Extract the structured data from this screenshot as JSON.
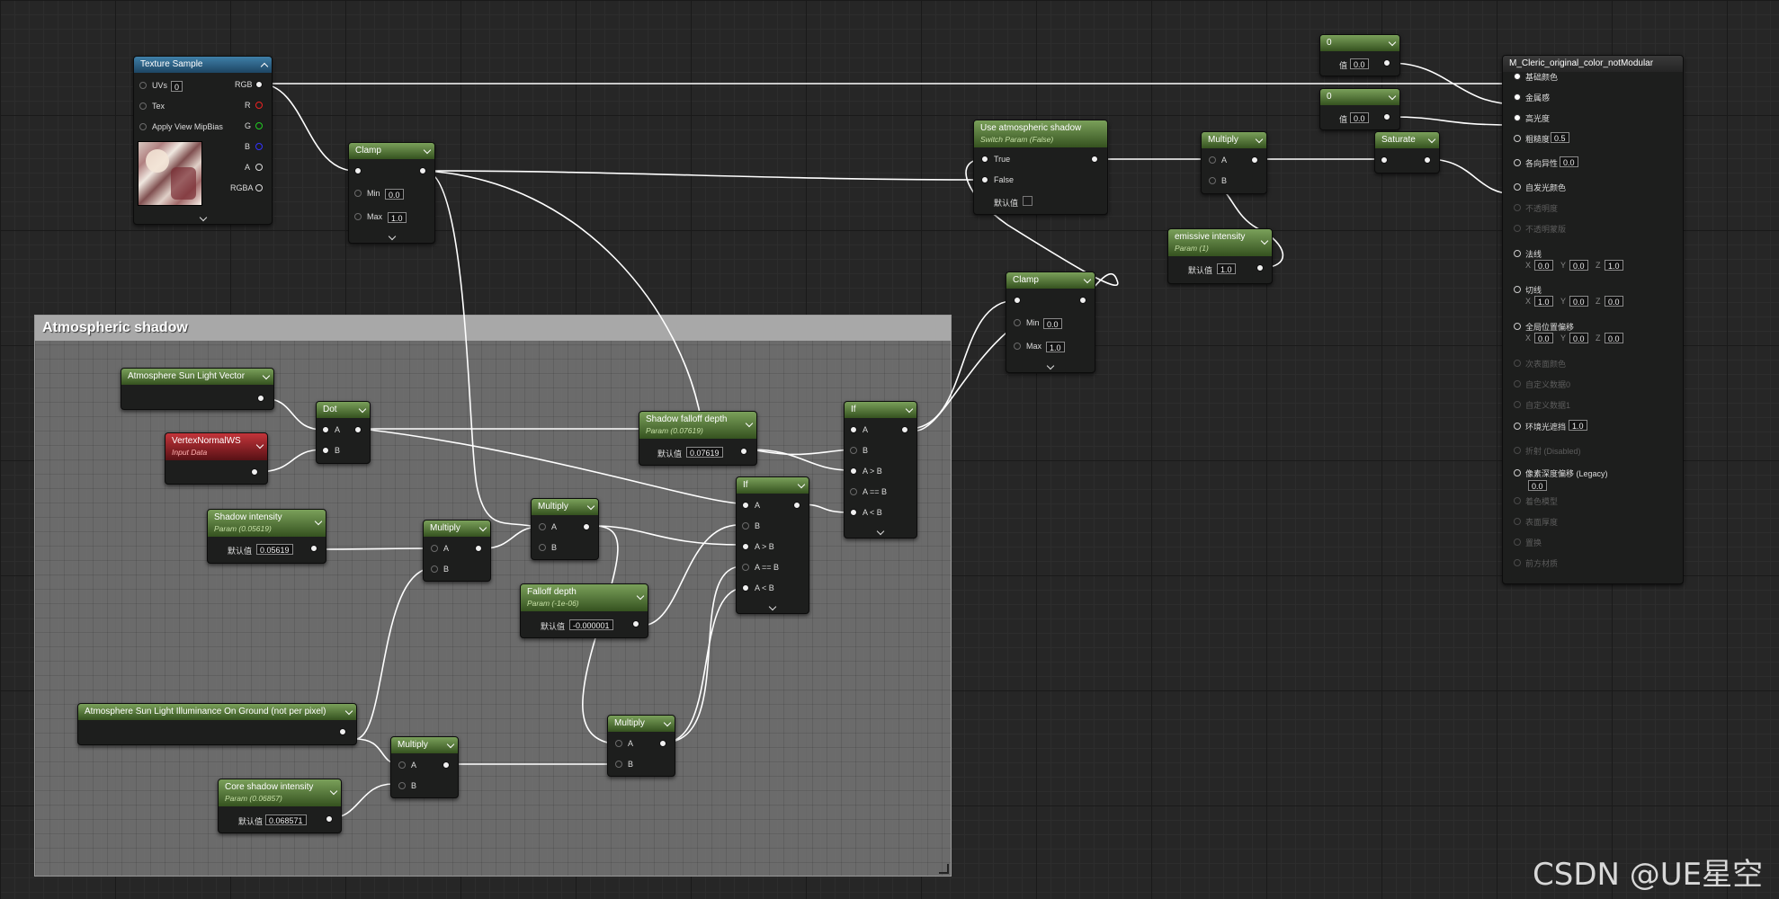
{
  "comment": {
    "title": "Atmospheric shadow"
  },
  "texture_sample": {
    "title": "Texture Sample",
    "uvs": "UVs",
    "uvs_value": "0",
    "tex": "Tex",
    "mip": "Apply View MipBias",
    "rgb": "RGB",
    "r": "R",
    "g": "G",
    "b": "B",
    "a": "A",
    "rgba": "RGBA"
  },
  "clamp1": {
    "title": "Clamp",
    "min_label": "Min",
    "min": "0.0",
    "max_label": "Max",
    "max": "1.0"
  },
  "clamp2": {
    "title": "Clamp",
    "min_label": "Min",
    "min": "0.0",
    "max_label": "Max",
    "max": "1.0"
  },
  "const_a": {
    "title": "0",
    "label": "值",
    "value": "0.0"
  },
  "const_b": {
    "title": "0",
    "label": "值",
    "value": "0.0"
  },
  "use_atmo": {
    "title": "Use atmospheric shadow",
    "sub": "Switch Param (False)",
    "true_label": "True",
    "false_label": "False",
    "default_label": "默认值"
  },
  "multiply_top": {
    "title": "Multiply",
    "a": "A",
    "b": "B"
  },
  "saturate": {
    "title": "Saturate"
  },
  "emissive": {
    "title": "emissive intensity",
    "sub": "Param (1)",
    "label": "默认值",
    "value": "1.0"
  },
  "material": {
    "title": "M_Cleric_original_color_notModular",
    "pins": [
      {
        "label": "基础颜色"
      },
      {
        "label": "金属感"
      },
      {
        "label": "高光度"
      },
      {
        "label": "粗糙度",
        "v": "0.5"
      },
      {
        "label": "各向异性",
        "v": "0.0"
      },
      {
        "label": "自发光颜色"
      },
      {
        "label": "不透明度"
      },
      {
        "label": "不透明蒙版"
      },
      {
        "label": "法线",
        "x": "0.0",
        "y": "0.0",
        "z": "1.0"
      },
      {
        "label": "切线",
        "x": "1.0",
        "y": "0.0",
        "z": "0.0"
      },
      {
        "label": "全局位置偏移",
        "x": "0.0",
        "y": "0.0",
        "z": "0.0"
      },
      {
        "label": "次表面颜色"
      },
      {
        "label": "自定义数据0"
      },
      {
        "label": "自定义数据1"
      },
      {
        "label": "环境光遮挡",
        "v": "1.0"
      },
      {
        "label": "折射 (Disabled)"
      },
      {
        "label": "像素深度偏移 (Legacy)",
        "v": "0.0"
      },
      {
        "label": "着色模型"
      },
      {
        "label": "表面厚度"
      },
      {
        "label": "置换"
      },
      {
        "label": "前方材质"
      }
    ],
    "x_label": "X",
    "y_label": "Y",
    "z_label": "Z"
  },
  "sun_vec": {
    "title": "Atmosphere Sun Light Vector"
  },
  "vertex_normal": {
    "title": "VertexNormalWS",
    "sub": "Input Data"
  },
  "dot": {
    "title": "Dot",
    "a": "A",
    "b": "B"
  },
  "shadow_intensity": {
    "title": "Shadow intensity",
    "sub": "Param (0.05619)",
    "label": "默认值",
    "value": "0.05619"
  },
  "multiply_a": {
    "title": "Multiply",
    "a": "A",
    "b": "B"
  },
  "multiply_b": {
    "title": "Multiply",
    "a": "A",
    "b": "B"
  },
  "shadow_falloff": {
    "title": "Shadow falloff depth",
    "sub": "Param (0.07619)",
    "label": "默认值",
    "value": "0.07619"
  },
  "falloff_depth": {
    "title": "Falloff depth",
    "sub": "Param (-1e-06)",
    "label": "默认值",
    "value": "-0.000001"
  },
  "if1": {
    "title": "If",
    "a": "A",
    "b": "B",
    "gt": "A > B",
    "eq": "A == B",
    "lt": "A < B"
  },
  "if2": {
    "title": "If",
    "a": "A",
    "b": "B",
    "gt": "A > B",
    "eq": "A == B",
    "lt": "A < B"
  },
  "sun_illum": {
    "title": "Atmosphere Sun Light Illuminance On Ground (not per pixel)"
  },
  "multiply_c": {
    "title": "Multiply",
    "a": "A",
    "b": "B"
  },
  "multiply_d": {
    "title": "Multiply",
    "a": "A",
    "b": "B"
  },
  "core_shadow": {
    "title": "Core shadow intensity",
    "sub": "Param (0.06857)",
    "label": "默认值",
    "value": "0.068571"
  },
  "watermark": "CSDN @UE星空"
}
